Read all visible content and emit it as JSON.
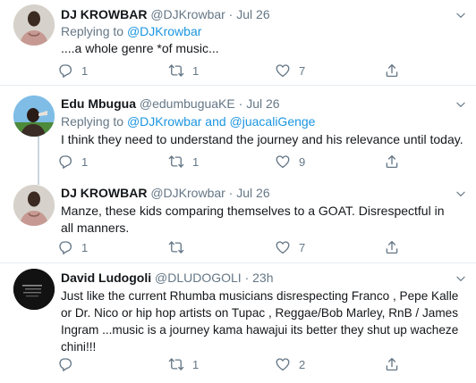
{
  "tweets": [
    {
      "name": "DJ KROWBAR",
      "handle": "@DJKrowbar",
      "sep": " · ",
      "time": "Jul 26",
      "replying_prefix": "Replying to ",
      "replying_to": "@DJKrowbar",
      "text": "....a whole genre *of music...",
      "replies": "1",
      "retweets": "1",
      "likes": "7"
    },
    {
      "name": "Edu Mbugua",
      "handle": "@edumbuguaKE",
      "sep": " · ",
      "time": "Jul 26",
      "replying_prefix": "Replying to ",
      "replying_to": "@DJKrowbar and @juacaliGenge",
      "text": "I think they need to understand the journey and his relevance until today.",
      "replies": "1",
      "retweets": "1",
      "likes": "9"
    },
    {
      "name": "DJ KROWBAR",
      "handle": "@DJKrowbar",
      "sep": " · ",
      "time": "Jul 26",
      "text": "Manze, these kids comparing themselves to a GOAT. Disrespectful in all manners.",
      "replies": "1",
      "retweets": "",
      "likes": "7"
    },
    {
      "name": "David Ludogoli",
      "handle": "@DLUDOGOLI",
      "sep": " · ",
      "time": "23h",
      "text": "Just like the current Rhumba musicians disrespecting Franco , Pepe Kalle or Dr. Nico or hip hop artists on Tupac , Reggae/Bob Marley, RnB / James Ingram ...music is a journey kama hawajui its better they shut up wacheze chini!!!",
      "replies": "",
      "retweets": "1",
      "likes": "2"
    }
  ]
}
